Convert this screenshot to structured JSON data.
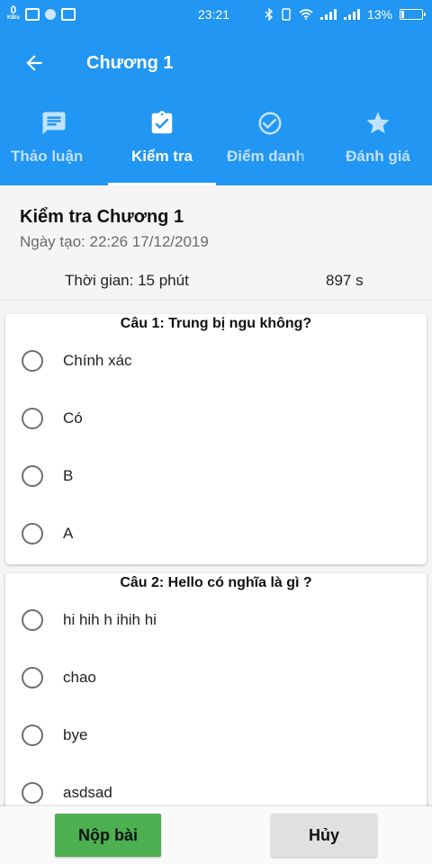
{
  "statusbar": {
    "kbs_value": "0",
    "kbs_unit": "KB/s",
    "time": "23:21",
    "battery": "13%",
    "battery_level": 0.13
  },
  "appbar": {
    "title": "Chương 1",
    "tabs": [
      {
        "label": "Thảo luận",
        "icon": "chat-icon"
      },
      {
        "label": "Kiểm tra",
        "icon": "clipboard-check-icon"
      },
      {
        "label": "Điểm danh",
        "icon": "check-circle-icon"
      },
      {
        "label": "Đánh giá",
        "icon": "star-icon"
      }
    ],
    "active_tab": 1
  },
  "quiz": {
    "title": "Kiểm tra Chương 1",
    "created": "Ngày tạo: 22:26 17/12/2019",
    "time_label": "Thời gian: 15 phút",
    "time_left": "897 s"
  },
  "questions": [
    {
      "title": "Câu 1: Trung bị ngu không?",
      "options": [
        "Chính xác",
        "Có",
        "B",
        "A"
      ]
    },
    {
      "title": "Câu 2: Hello có nghĩa là gì ?",
      "options": [
        "hi hih h ihih hi",
        "chao",
        "bye",
        "asdsad"
      ]
    }
  ],
  "actions": {
    "submit": "Nộp bài",
    "cancel": "Hủy"
  },
  "colors": {
    "primary": "#2196F3",
    "submit": "#4CAF50",
    "cancel": "#e0e0e0"
  }
}
